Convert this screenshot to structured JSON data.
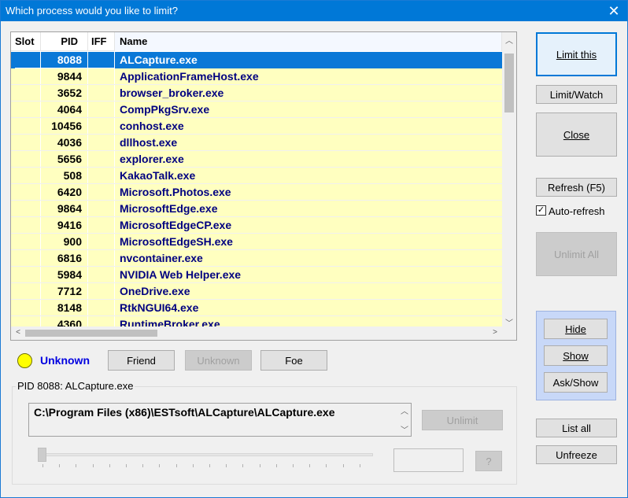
{
  "window": {
    "title": "Which process would you like to limit?",
    "close_glyph": "✕"
  },
  "list": {
    "columns": {
      "slot": "Slot",
      "pid": "PID",
      "iff": "IFF",
      "name": "Name"
    },
    "rows": [
      {
        "slot": "",
        "pid": "8088",
        "iff": "",
        "name": "ALCapture.exe",
        "selected": true
      },
      {
        "slot": "",
        "pid": "9844",
        "iff": "",
        "name": "ApplicationFrameHost.exe"
      },
      {
        "slot": "",
        "pid": "3652",
        "iff": "",
        "name": "browser_broker.exe"
      },
      {
        "slot": "",
        "pid": "4064",
        "iff": "",
        "name": "CompPkgSrv.exe"
      },
      {
        "slot": "",
        "pid": "10456",
        "iff": "",
        "name": "conhost.exe"
      },
      {
        "slot": "",
        "pid": "4036",
        "iff": "",
        "name": "dllhost.exe"
      },
      {
        "slot": "",
        "pid": "5656",
        "iff": "",
        "name": "explorer.exe"
      },
      {
        "slot": "",
        "pid": "508",
        "iff": "",
        "name": "KakaoTalk.exe"
      },
      {
        "slot": "",
        "pid": "6420",
        "iff": "",
        "name": "Microsoft.Photos.exe"
      },
      {
        "slot": "",
        "pid": "9864",
        "iff": "",
        "name": "MicrosoftEdge.exe"
      },
      {
        "slot": "",
        "pid": "9416",
        "iff": "",
        "name": "MicrosoftEdgeCP.exe"
      },
      {
        "slot": "",
        "pid": "900",
        "iff": "",
        "name": "MicrosoftEdgeSH.exe"
      },
      {
        "slot": "",
        "pid": "6816",
        "iff": "",
        "name": "nvcontainer.exe"
      },
      {
        "slot": "",
        "pid": "5984",
        "iff": "",
        "name": "NVIDIA Web Helper.exe"
      },
      {
        "slot": "",
        "pid": "7712",
        "iff": "",
        "name": "OneDrive.exe"
      },
      {
        "slot": "",
        "pid": "8148",
        "iff": "",
        "name": "RtkNGUI64.exe"
      },
      {
        "slot": "",
        "pid": "4360",
        "iff": "",
        "name": "RuntimeBroker.exe"
      }
    ]
  },
  "side": {
    "limit_this": "Limit this",
    "limit_watch": "Limit/Watch",
    "close": "Close",
    "refresh": "Refresh (F5)",
    "auto_refresh": {
      "label": "Auto-refresh",
      "checked": true
    },
    "unlimit_all": "Unlimit All",
    "hide": "Hide",
    "show": "Show",
    "ask_show": "Ask/Show",
    "list_all": "List all",
    "unfreeze": "Unfreeze"
  },
  "status": {
    "text": "Unknown",
    "color": "#ffff00"
  },
  "iff_buttons": {
    "friend": "Friend",
    "unknown": "Unknown",
    "foe": "Foe"
  },
  "detail": {
    "group_label": "PID 8088: ALCapture.exe",
    "path": "C:\\Program Files (x86)\\ESTsoft\\ALCapture\\ALCapture.exe",
    "unlimit": "Unlimit",
    "help": "?",
    "slider_value": 0
  },
  "colors": {
    "accent": "#0078d7",
    "row_bg": "#ffffc0",
    "name_text": "#000080",
    "status_text": "#0000e0"
  }
}
